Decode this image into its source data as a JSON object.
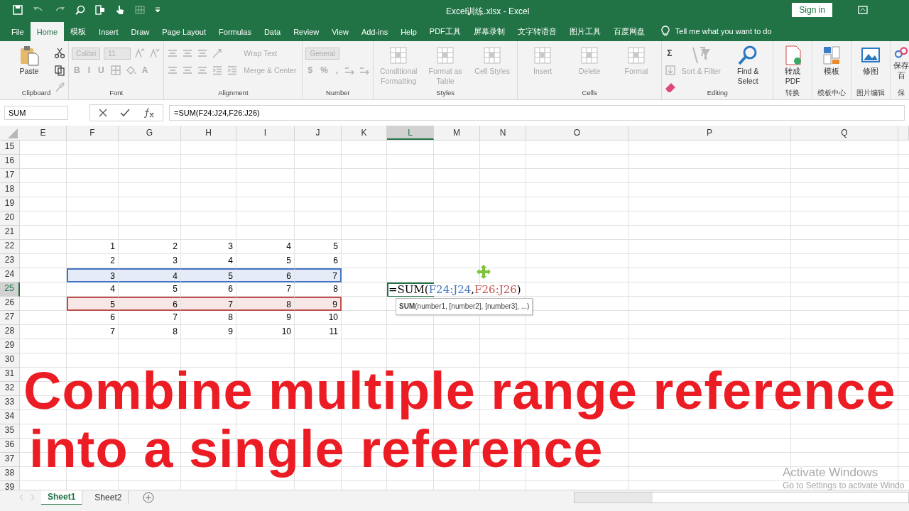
{
  "title_bar": {
    "title": "Excel训练.xlsx  -  Excel",
    "sign_in": "Sign in"
  },
  "menu_tabs": [
    {
      "label": "File",
      "selected": false
    },
    {
      "label": "Home",
      "selected": true
    },
    {
      "label": "模板",
      "selected": false
    },
    {
      "label": "Insert",
      "selected": false
    },
    {
      "label": "Draw",
      "selected": false
    },
    {
      "label": "Page Layout",
      "selected": false
    },
    {
      "label": "Formulas",
      "selected": false
    },
    {
      "label": "Data",
      "selected": false
    },
    {
      "label": "Review",
      "selected": false
    },
    {
      "label": "View",
      "selected": false
    },
    {
      "label": "Add-ins",
      "selected": false
    },
    {
      "label": "Help",
      "selected": false
    },
    {
      "label": "PDF工具",
      "selected": false
    },
    {
      "label": "屏幕录制",
      "selected": false
    },
    {
      "label": "文字转语音",
      "selected": false
    },
    {
      "label": "图片工具",
      "selected": false
    },
    {
      "label": "百度网盘",
      "selected": false
    }
  ],
  "tell_me": "Tell me what you want to do",
  "ribbon": [
    {
      "label": "Clipboard",
      "sections": [
        {
          "kind": "large",
          "label": "Paste",
          "disabled": false
        },
        {
          "kind": "stack",
          "rows": [
            {
              "items": [
                {
                  "kind": "icon",
                  "disabled": false
                }
              ]
            },
            {
              "items": [
                {
                  "kind": "icon",
                  "disabled": false
                }
              ]
            },
            {
              "items": [
                {
                  "kind": "icon",
                  "disabled": true
                }
              ]
            }
          ]
        }
      ]
    },
    {
      "label": "Font",
      "sections": [
        {
          "kind": "stack",
          "rows": [
            {
              "items": [
                {
                  "kind": "field",
                  "value": "Calibri",
                  "disabled": true
                },
                {
                  "kind": "field",
                  "value": "11",
                  "disabled": true
                },
                {
                  "kind": "icon",
                  "disabled": true
                },
                {
                  "kind": "icon",
                  "disabled": true
                }
              ]
            },
            {
              "items": [
                {
                  "kind": "glyph",
                  "label": "B",
                  "disabled": true
                },
                {
                  "kind": "glyph",
                  "label": "I",
                  "disabled": true
                },
                {
                  "kind": "glyph",
                  "label": "U",
                  "disabled": true
                },
                {
                  "kind": "icon",
                  "disabled": true
                },
                {
                  "kind": "icon",
                  "disabled": true
                },
                {
                  "kind": "glyph",
                  "label": "A",
                  "disabled": true
                }
              ]
            }
          ]
        }
      ]
    },
    {
      "label": "Alignment",
      "sections": [
        {
          "kind": "stack",
          "rows": [
            {
              "items": [
                {
                  "kind": "icon",
                  "disabled": true
                },
                {
                  "kind": "icon",
                  "disabled": true
                },
                {
                  "kind": "icon",
                  "disabled": true
                },
                {
                  "kind": "icon",
                  "disabled": true
                }
              ]
            },
            {
              "items": [
                {
                  "kind": "icon",
                  "disabled": true
                },
                {
                  "kind": "icon",
                  "disabled": true
                },
                {
                  "kind": "icon",
                  "disabled": true
                },
                {
                  "kind": "icon",
                  "disabled": true
                },
                {
                  "kind": "icon",
                  "disabled": true
                }
              ]
            }
          ]
        },
        {
          "kind": "stack",
          "rows": [
            {
              "items": [
                {
                  "kind": "small",
                  "label": "Wrap Text",
                  "disabled": true
                }
              ]
            },
            {
              "items": [
                {
                  "kind": "small",
                  "label": "Merge & Center",
                  "disabled": true
                }
              ]
            }
          ]
        }
      ]
    },
    {
      "label": "Number",
      "sections": [
        {
          "kind": "stack",
          "rows": [
            {
              "items": [
                {
                  "kind": "field",
                  "value": "General",
                  "disabled": true
                }
              ]
            },
            {
              "items": [
                {
                  "kind": "glyph",
                  "label": "$",
                  "disabled": true
                },
                {
                  "kind": "glyph",
                  "label": "%",
                  "disabled": true
                },
                {
                  "kind": "glyph",
                  "label": ",",
                  "disabled": true
                },
                {
                  "kind": "icon",
                  "disabled": true
                },
                {
                  "kind": "icon",
                  "disabled": true
                }
              ]
            }
          ]
        }
      ]
    },
    {
      "label": "Styles",
      "sections": [
        {
          "kind": "large",
          "label": "Conditional Formatting",
          "disabled": true
        },
        {
          "kind": "large",
          "label": "Format as Table",
          "disabled": true
        },
        {
          "kind": "large",
          "label": "Cell Styles",
          "disabled": true
        }
      ]
    },
    {
      "label": "Cells",
      "sections": [
        {
          "kind": "large",
          "label": "Insert",
          "disabled": true
        },
        {
          "kind": "large",
          "label": "Delete",
          "disabled": true
        },
        {
          "kind": "large",
          "label": "Format",
          "disabled": true
        }
      ]
    },
    {
      "label": "Editing",
      "sections": [
        {
          "kind": "stack",
          "rows": [
            {
              "items": [
                {
                  "kind": "glyph",
                  "label": "Σ",
                  "disabled": false
                }
              ]
            },
            {
              "items": [
                {
                  "kind": "icon",
                  "disabled": true
                }
              ]
            },
            {
              "items": [
                {
                  "kind": "icon",
                  "disabled": false
                }
              ]
            }
          ]
        },
        {
          "kind": "large",
          "label": "Sort & Filter",
          "disabled": true
        },
        {
          "kind": "large",
          "label": "Find & Select",
          "disabled": false
        }
      ]
    },
    {
      "label": "转换",
      "sections": [
        {
          "kind": "large",
          "label": "转成 PDF",
          "disabled": false
        }
      ]
    },
    {
      "label": "模板中心",
      "sections": [
        {
          "kind": "large",
          "label": "模板",
          "disabled": false
        }
      ]
    },
    {
      "label": "图片编辑",
      "sections": [
        {
          "kind": "large",
          "label": "修图",
          "disabled": false
        }
      ]
    },
    {
      "label": "保",
      "sections": [
        {
          "kind": "large",
          "label": "保存百",
          "disabled": false
        }
      ]
    }
  ],
  "formula_bar": {
    "name_box": "SUM",
    "formula": "=SUM(F24:J24,F26:J26)"
  },
  "columns": [
    {
      "label": "E",
      "selected": false
    },
    {
      "label": "F",
      "selected": false
    },
    {
      "label": "G",
      "selected": false
    },
    {
      "label": "H",
      "selected": false
    },
    {
      "label": "I",
      "selected": false
    },
    {
      "label": "J",
      "selected": false
    },
    {
      "label": "K",
      "selected": false
    },
    {
      "label": "L",
      "selected": true
    },
    {
      "label": "M",
      "selected": false
    },
    {
      "label": "N",
      "selected": false
    },
    {
      "label": "O",
      "selected": false
    },
    {
      "label": "P",
      "selected": false
    },
    {
      "label": "Q",
      "selected": false
    }
  ],
  "rows": [
    {
      "label": "15",
      "selected": false
    },
    {
      "label": "16",
      "selected": false
    },
    {
      "label": "17",
      "selected": false
    },
    {
      "label": "18",
      "selected": false
    },
    {
      "label": "19",
      "selected": false
    },
    {
      "label": "20",
      "selected": false
    },
    {
      "label": "21",
      "selected": false
    },
    {
      "label": "22",
      "selected": false,
      "values": [
        "1",
        "2",
        "3",
        "4",
        "5"
      ]
    },
    {
      "label": "23",
      "selected": false,
      "values": [
        "2",
        "3",
        "4",
        "5",
        "6"
      ]
    },
    {
      "label": "24",
      "selected": false,
      "values": [
        "3",
        "4",
        "5",
        "6",
        "7"
      ],
      "color": "#4472c4"
    },
    {
      "label": "25",
      "selected": true,
      "values": [
        "4",
        "5",
        "6",
        "7",
        "8"
      ]
    },
    {
      "label": "26",
      "selected": false,
      "values": [
        "5",
        "6",
        "7",
        "8",
        "9"
      ],
      "color": "#c0504d"
    },
    {
      "label": "27",
      "selected": false,
      "values": [
        "6",
        "7",
        "8",
        "9",
        "10"
      ]
    },
    {
      "label": "28",
      "selected": false,
      "values": [
        "7",
        "8",
        "9",
        "10",
        "11"
      ]
    },
    {
      "label": "29",
      "selected": false
    },
    {
      "label": "30",
      "selected": false
    },
    {
      "label": "31",
      "selected": false
    },
    {
      "label": "32",
      "selected": false
    },
    {
      "label": "33",
      "selected": false
    },
    {
      "label": "34",
      "selected": false
    },
    {
      "label": "35",
      "selected": false
    },
    {
      "label": "36",
      "selected": false
    },
    {
      "label": "37",
      "selected": false
    },
    {
      "label": "38",
      "selected": false
    },
    {
      "label": "39",
      "selected": false
    }
  ],
  "editing_cell": {
    "parts": [
      {
        "text": "=SUM("
      },
      {
        "text": "F24:J24",
        "color": "#4472c4"
      },
      {
        "text": ","
      },
      {
        "text": "F26:J26",
        "color": "#c0504d"
      },
      {
        "text": ")"
      }
    ],
    "tooltip": "**SUM**(number1, [number2], [number3], ...)"
  },
  "caption": [
    "Combine multiple range reference",
    "into a single reference"
  ],
  "activation_notice": {
    "title": "Activate Windows",
    "subtitle": "Go to Settings to activate Windo"
  },
  "sheet_tabs": [
    {
      "label": "Sheet1",
      "selected": true
    },
    {
      "label": "Sheet2",
      "selected": false
    }
  ]
}
